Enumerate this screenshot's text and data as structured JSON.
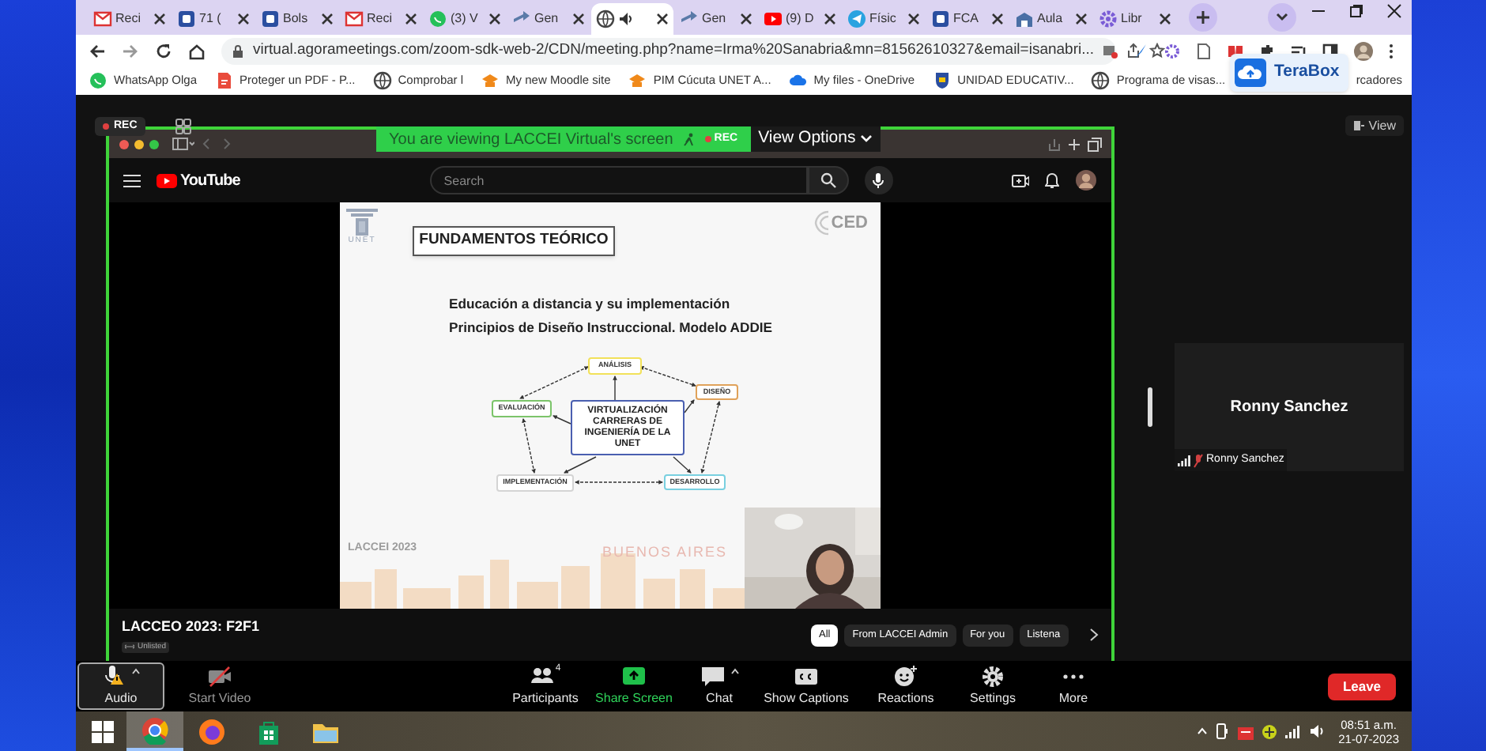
{
  "browser": {
    "tabs": [
      {
        "label": "Reci",
        "kind": "mail",
        "selected": false,
        "audio": false
      },
      {
        "label": "71 (",
        "kind": "square",
        "selected": false,
        "audio": false
      },
      {
        "label": "Bols",
        "kind": "square",
        "selected": false,
        "audio": false
      },
      {
        "label": "Reci",
        "kind": "mail",
        "selected": false,
        "audio": false
      },
      {
        "label": "(3) V",
        "kind": "chat",
        "selected": false,
        "audio": false
      },
      {
        "label": "Gen",
        "kind": "arrow",
        "selected": false,
        "audio": false
      },
      {
        "kind": "globe",
        "selected": true,
        "audio": true
      },
      {
        "label": "Gen",
        "kind": "arrow",
        "selected": false,
        "audio": false
      },
      {
        "label": "(9) D",
        "kind": "play",
        "selected": false,
        "audio": false
      },
      {
        "label": "Físic",
        "kind": "plane",
        "selected": false,
        "audio": false
      },
      {
        "label": "FCA",
        "kind": "square",
        "selected": false,
        "audio": false
      },
      {
        "label": "Aula",
        "kind": "building",
        "selected": false,
        "audio": false
      },
      {
        "label": "Libr",
        "kind": "gear",
        "selected": false,
        "audio": false
      }
    ],
    "address": "virtual.agorameetings.com/zoom-sdk-web-2/CDN/meeting.php?name=Irma%20Sanabria&mn=81562610327&email=isanabri...",
    "bookmarks": [
      {
        "label": "WhatsApp Olga",
        "kind": "chat"
      },
      {
        "label": "Proteger un PDF - P...",
        "kind": "pdf"
      },
      {
        "label": "Comprobar l",
        "kind": "globe"
      },
      {
        "label": "My new Moodle site",
        "kind": "hat"
      },
      {
        "label": "PIM Cúcuta UNET A...",
        "kind": "hat"
      },
      {
        "label": "My files - OneDrive",
        "kind": "cloud"
      },
      {
        "label": "UNIDAD EDUCATIV...",
        "kind": "shield"
      },
      {
        "label": "Programa de visas...",
        "kind": "globe"
      }
    ],
    "bookmarks_overflow": "rcadores",
    "terabox": "TeraBox"
  },
  "meeting": {
    "rec_badge": "REC",
    "banner": {
      "text": "You are viewing LACCEI Virtual's screen",
      "rec": "REC",
      "view_options": "View Options"
    },
    "shared": {
      "youtube_logo": "YouTube",
      "search_placeholder": "Search",
      "slide": {
        "heading": "FUNDAMENTOS TEÓRICO",
        "logo_left": "UNET",
        "logo_right": "CED",
        "lines": [
          "Educación a distancia y su implementación",
          "Principios de Diseño Instruccional. Modelo ADDIE"
        ],
        "center": "VIRTUALIZACIÓN CARRERAS DE INGENIERÍA DE LA UNET",
        "nodes": [
          {
            "label": "ANÁLISIS",
            "color": "#f2e15a"
          },
          {
            "label": "DISEÑO",
            "color": "#e0a25a"
          },
          {
            "label": "EVALUACIÓN",
            "color": "#7cc46a"
          },
          {
            "label": "IMPLEMENTACIÓN",
            "color": "#d4d4d4"
          },
          {
            "label": "DESARROLLO",
            "color": "#79d0e0"
          }
        ],
        "footer_left": "LACCEI 2023",
        "footer_center": "BUENOS AIRES"
      },
      "video_title": "LACCEO 2023: F2F1",
      "visibility": "Unlisted",
      "chips": [
        {
          "label": "All",
          "selected": true
        },
        {
          "label": "From LACCEI Admin",
          "selected": false
        },
        {
          "label": "For you",
          "selected": false
        },
        {
          "label": "Listena",
          "selected": false
        }
      ]
    },
    "view_button": "View",
    "participant": {
      "name": "Ronny Sanchez",
      "label": "Ronny Sanchez",
      "muted": true
    }
  },
  "toolbar": [
    {
      "kind": "audio",
      "label": "Audio",
      "selected": true,
      "menu": true
    },
    {
      "kind": "video",
      "label": "Start Video",
      "selected": false,
      "menu": false
    },
    {
      "kind": "participants",
      "label": "Participants",
      "badge": "4",
      "selected": false,
      "menu": false
    },
    {
      "kind": "share",
      "label": "Share Screen",
      "selected": false,
      "menu": false
    },
    {
      "kind": "chat",
      "label": "Chat",
      "selected": false,
      "menu": true
    },
    {
      "kind": "captions",
      "label": "Show Captions",
      "selected": false,
      "menu": false
    },
    {
      "kind": "reactions",
      "label": "Reactions",
      "selected": false,
      "menu": false
    },
    {
      "kind": "settings",
      "label": "Settings",
      "selected": false,
      "menu": false
    },
    {
      "kind": "more",
      "label": "More",
      "selected": false,
      "menu": false
    }
  ],
  "leave": "Leave",
  "taskbar": {
    "apps": [
      {
        "kind": "chrome",
        "selected": true
      },
      {
        "kind": "firefox",
        "selected": false
      },
      {
        "kind": "store",
        "selected": false
      },
      {
        "kind": "folder",
        "selected": false
      }
    ],
    "time": "08:51 a.m.",
    "date": "21-07-2023"
  }
}
